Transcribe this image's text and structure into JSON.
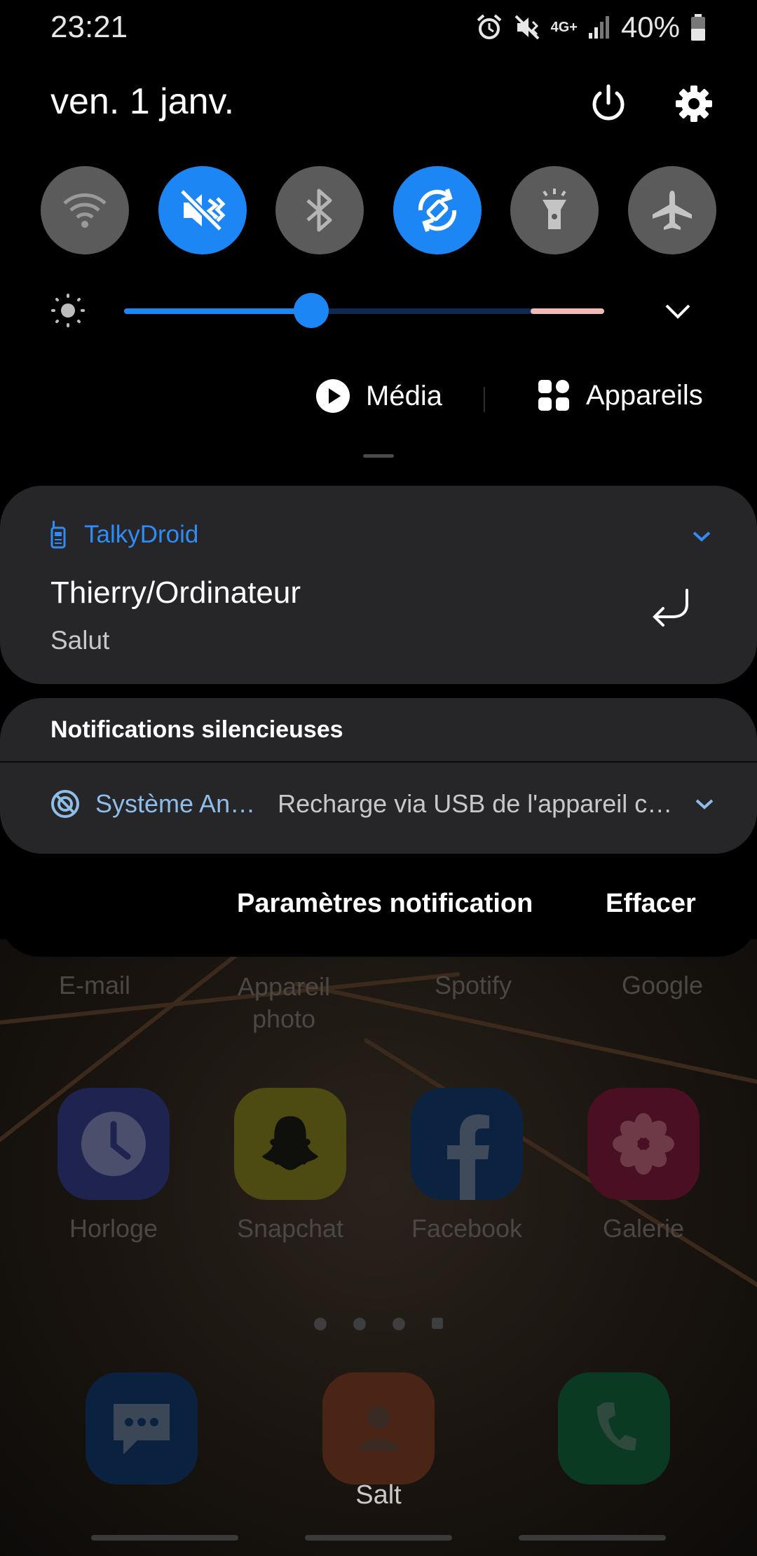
{
  "status_bar": {
    "time": "23:21",
    "network": "4G+",
    "battery": "40%"
  },
  "header": {
    "date": "ven. 1 janv."
  },
  "quick_tiles": [
    {
      "name": "wifi",
      "icon": "wifi-icon",
      "on": false
    },
    {
      "name": "sound-mute",
      "icon": "vibrate-mute-icon",
      "on": true
    },
    {
      "name": "bluetooth",
      "icon": "bluetooth-icon",
      "on": false
    },
    {
      "name": "auto-rotate",
      "icon": "rotate-icon",
      "on": true
    },
    {
      "name": "flashlight",
      "icon": "flashlight-icon",
      "on": false
    },
    {
      "name": "airplane-mode",
      "icon": "airplane-icon",
      "on": false
    }
  ],
  "brightness": {
    "level": 0.39
  },
  "media": {
    "media_label": "Média",
    "devices_label": "Appareils"
  },
  "notification": {
    "app": "TalkyDroid",
    "title": "Thierry/Ordinateur",
    "body": "Salut"
  },
  "silent": {
    "header": "Notifications silencieuses",
    "app": "Système An…",
    "message": "Recharge via USB de l'appareil c…"
  },
  "actions": {
    "settings_label": "Paramètres notification",
    "clear_label": "Effacer"
  },
  "home": {
    "top_labels": [
      "E-mail",
      "Appareil\nphoto",
      "Spotify",
      "Google"
    ],
    "apps": [
      "Horloge",
      "Snapchat",
      "Facebook",
      "Galerie"
    ],
    "dock_label": "Salt"
  },
  "colors": {
    "accent": "#1c86f5",
    "app_name": "#2f8cf5",
    "tile_off": "#5b5b5b",
    "card": "#262628"
  }
}
